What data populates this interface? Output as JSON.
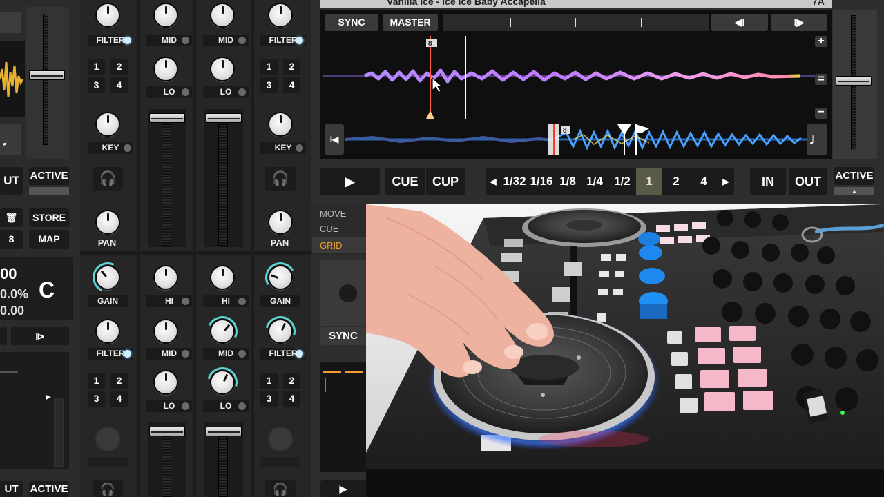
{
  "track": {
    "title": "Vanilla Ice - Ice Ice Baby Accapella",
    "key": "7A"
  },
  "deck_a": {
    "sync_label": "SYNC",
    "master_label": "MASTER",
    "hotcue_marker": "8",
    "play_icon": "play-icon",
    "cue_label": "CUE",
    "cup_label": "CUP",
    "loop_sizes": [
      "1/32",
      "1/16",
      "1/8",
      "1/4",
      "1/2",
      "1",
      "2",
      "4"
    ],
    "loop_active": "1",
    "in_label": "IN",
    "out_label": "OUT",
    "active_label": "ACTIVE",
    "zoom_in": "+",
    "zoom_reset": "=",
    "zoom_out": "−"
  },
  "left_deck": {
    "out_label": "UT",
    "active_label": "ACTIVE",
    "store_label": "STORE",
    "map_label": "MAP",
    "cue_number": "8",
    "bpm_partial": "00",
    "pitch_partial": "0.0%",
    "tempo_partial": "0.00",
    "deck_letter": "C",
    "out_label_bottom": "UT",
    "active_label_bottom": "ACTIVE"
  },
  "mixer": {
    "ch1_top": {
      "filter": "FILTER",
      "key": "KEY",
      "pan": "PAN",
      "fx": [
        "1",
        "2",
        "3",
        "4"
      ]
    },
    "ch2_top": {
      "mid": "MID",
      "lo": "LO"
    },
    "ch3_top": {
      "mid": "MID",
      "lo": "LO"
    },
    "ch4_top": {
      "filter": "FILTER",
      "key": "KEY",
      "pan": "PAN",
      "fx": [
        "1",
        "2",
        "3",
        "4"
      ]
    },
    "ch1_bot": {
      "gain": "GAIN",
      "filter": "FILTER",
      "fx": [
        "1",
        "2",
        "3",
        "4"
      ]
    },
    "ch2_bot": {
      "hi": "HI",
      "mid": "MID",
      "lo": "LO"
    },
    "ch3_bot": {
      "hi": "HI",
      "mid": "MID",
      "lo": "LO"
    },
    "ch4_bot": {
      "gain": "GAIN",
      "filter": "FILTER",
      "fx": [
        "1",
        "2",
        "3",
        "4"
      ]
    }
  },
  "grid_tabs": [
    "MOVE",
    "CUE",
    "GRID"
  ],
  "grid_tab_active": "GRID",
  "deck_d": {
    "sync_label": "SYNC"
  },
  "deck_b_partial": {
    "active_label": "ACTIVE"
  },
  "colors": {
    "accent_cyan": "#5fd6d6",
    "grid_orange": "#f0a030",
    "loop_active_bg": "#5a5a48"
  }
}
